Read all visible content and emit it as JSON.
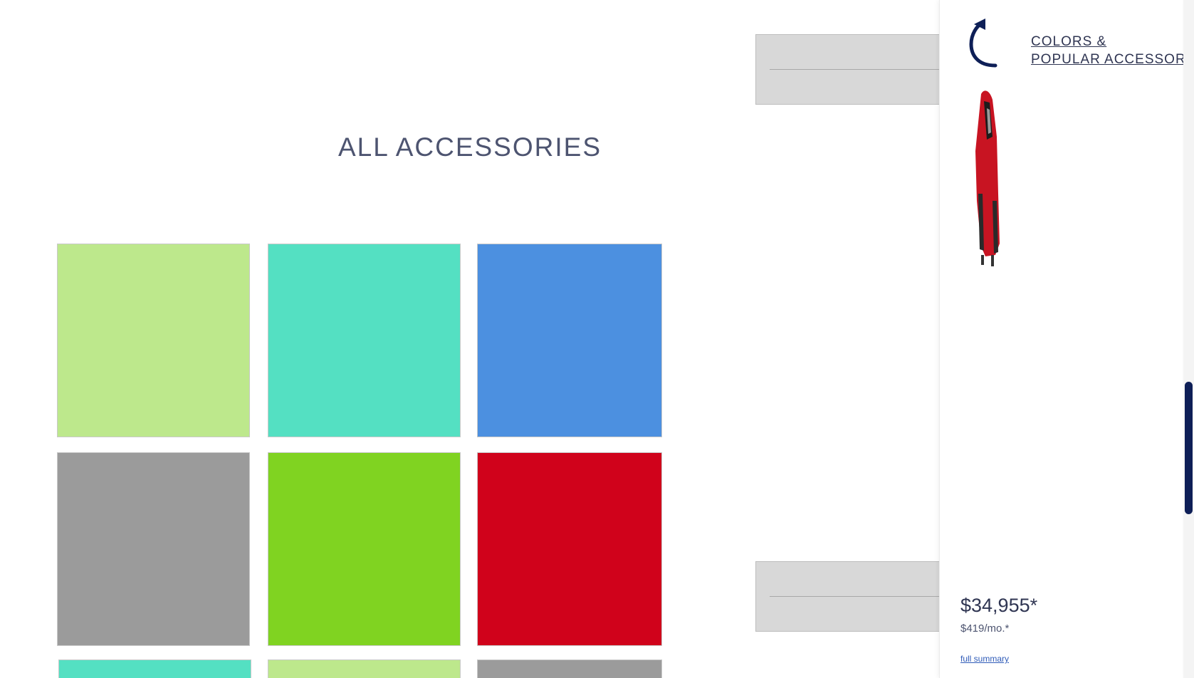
{
  "main": {
    "title": "ALL ACCESSORIES",
    "tiles": [
      {
        "color": "#bde88c"
      },
      {
        "color": "#54e0c2"
      },
      {
        "color": "#4c90e0"
      },
      {
        "color": "#9b9b9b"
      },
      {
        "color": "#80d321"
      },
      {
        "color": "#d0021b"
      },
      {
        "color": "#54e0c2"
      },
      {
        "color": "#bde88c"
      },
      {
        "color": "#9b9b9b"
      }
    ]
  },
  "sidebar": {
    "back_link_line1": "COLORS &",
    "back_link_line2": "POPULAR ACCESSORIES",
    "back_icon": "curved-back-arrow-icon",
    "car_image": "red-car-thumbnail",
    "price": "$34,955*",
    "monthly": "$419/mo.*",
    "full_summary": "full summary"
  },
  "colors": {
    "accent": "#0e1f57",
    "text": "#2f3552",
    "link": "#2f5bb8"
  }
}
